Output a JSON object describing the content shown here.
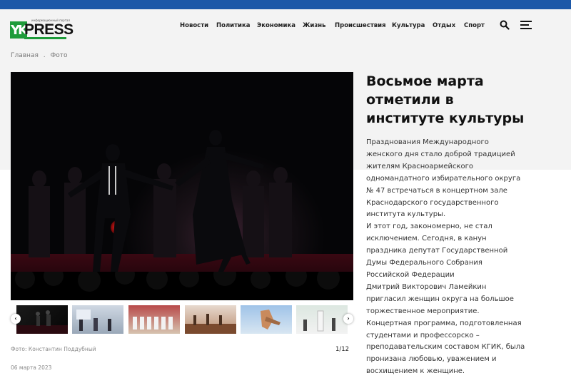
{
  "site": {
    "logo_text": "PRESS",
    "logo_mark": "YK",
    "logo_tagline": "информационный портал"
  },
  "nav": {
    "items": [
      {
        "label": "Новости"
      },
      {
        "label": "Политика"
      },
      {
        "label": "Экономика"
      },
      {
        "label": "Жизнь"
      },
      {
        "label": "Происшествия"
      },
      {
        "label": "Культура"
      },
      {
        "label": "Отдых"
      },
      {
        "label": "Спорт"
      }
    ]
  },
  "icons": {
    "search": "search-icon",
    "menu": "hamburger-menu-icon",
    "prev": "chevron-left-icon",
    "next": "chevron-right-icon"
  },
  "breadcrumb": {
    "home": "Главная",
    "separator": ".",
    "current": "Фото"
  },
  "article": {
    "title_lines": [
      "Восьмое марта",
      "отметили в",
      "институте культуры"
    ],
    "body_lines": [
      "Празднования Международного",
      "женского дня  стало доброй традицией",
      "жителям Красноармейского",
      "одномандатного избирательного округа",
      "№ 47  встречаться в концертном зале",
      "Краснодарского  государственного",
      "института культуры.",
      "И этот год, закономерно, не стал",
      "исключением. Сегодня, в канун",
      "праздника депутат Государственной",
      "Думы Федерального Собрания",
      "Российской Федерации",
      "Дмитрий  Викторович Ламейкин",
      "пригласил женщин округа на большое",
      "торжественное мероприятие.",
      "Концертная программа, подготовленная",
      "студентами и профессорско –",
      "преподавательским составом КГИК,  была",
      "пронизана любовью, уважением и",
      "восхищением к женщине."
    ]
  },
  "gallery": {
    "photo_credit": "Фото: Константин Поддубный",
    "counter": "1/12",
    "current_index": 1,
    "total": 12,
    "date": "06 марта 2023"
  },
  "colors": {
    "topbar": "#1c58a8",
    "brand_green": "#1e9b3a"
  }
}
